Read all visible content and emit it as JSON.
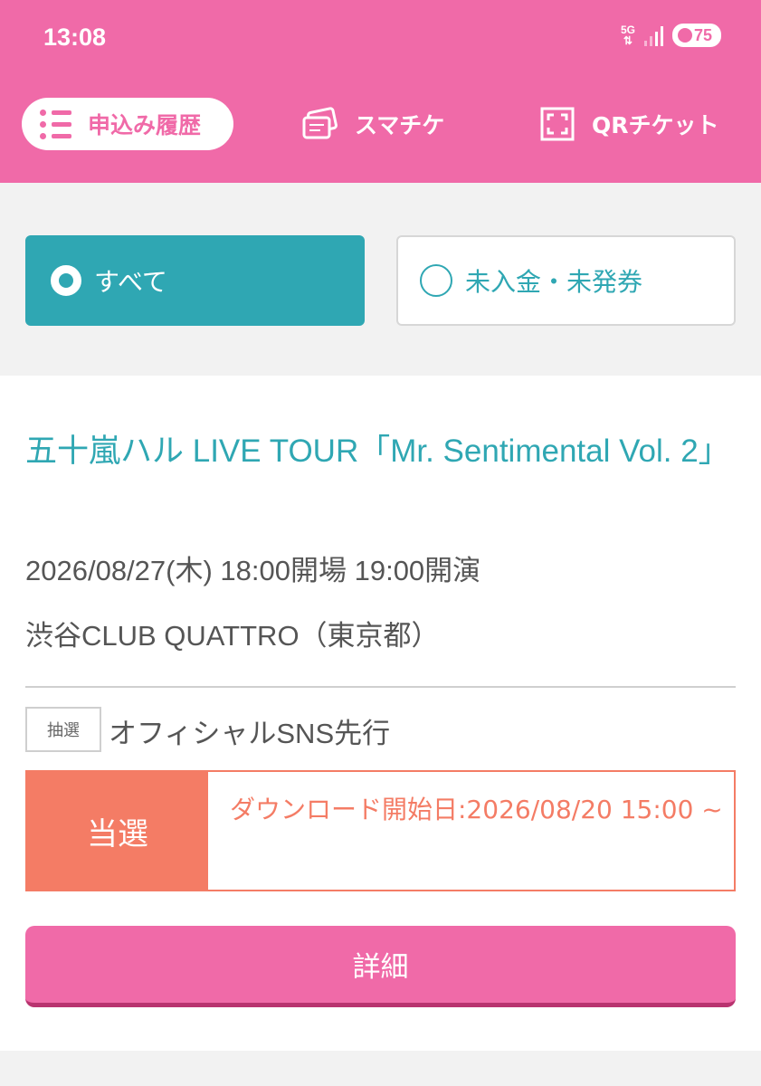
{
  "status_bar": {
    "time": "13:08",
    "network": "5G",
    "battery": "75"
  },
  "nav": {
    "history": "申込み履歴",
    "smachike": "スマチケ",
    "qr": "QRチケット"
  },
  "filters": {
    "all": "すべて",
    "unpaid": "未入金・未発券"
  },
  "event": {
    "title": "五十嵐ハル LIVE TOUR「Mr. Sentimental Vol. 2」",
    "datetime": "2026/08/27(木) 18:00開場 19:00開演",
    "venue": "渋谷CLUB QUATTRO（東京都）",
    "lottery_badge": "抽選",
    "sale_type": "オフィシャルSNS先行",
    "result_status": "当選",
    "download_info": "ダウンロード開始日:2026/08/20 15:00 ~",
    "detail_button": "詳細"
  },
  "colors": {
    "brand_pink": "#f06aa8",
    "teal": "#2fa7b3",
    "win_salmon": "#f47c65"
  }
}
